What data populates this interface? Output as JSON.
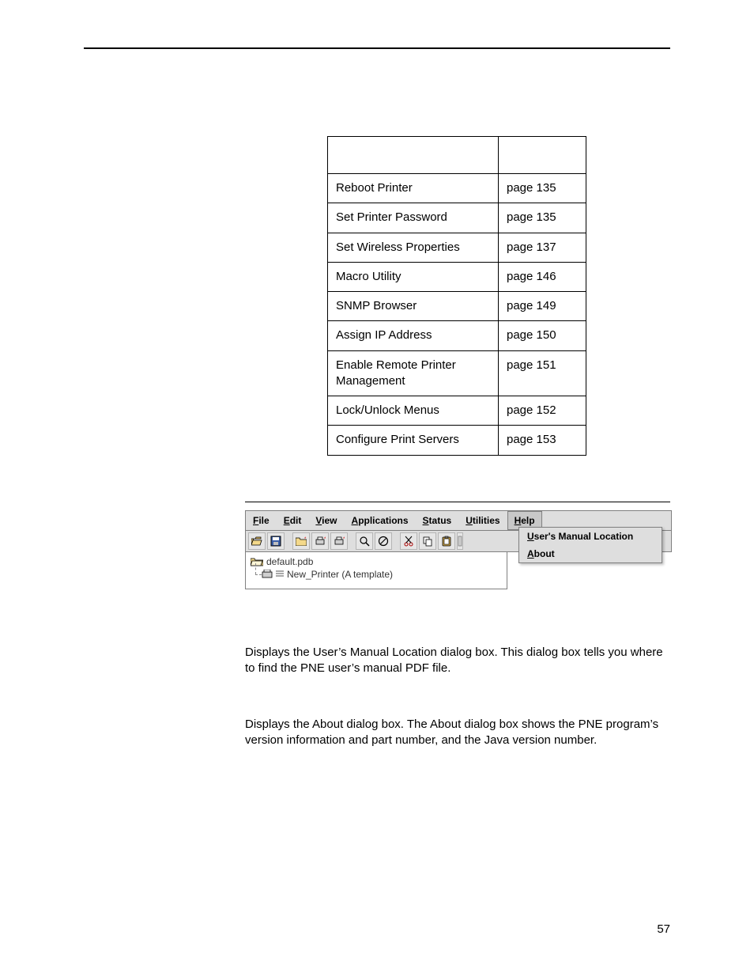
{
  "table": {
    "rows": [
      {
        "label": "Reboot Printer",
        "page": "page 135"
      },
      {
        "label": "Set Printer Password",
        "page": "page 135"
      },
      {
        "label": "Set Wireless Properties",
        "page": "page 137"
      },
      {
        "label": "Macro Utility",
        "page": "page 146"
      },
      {
        "label": "SNMP Browser",
        "page": "page 149"
      },
      {
        "label": "Assign IP Address",
        "page": "page 150"
      },
      {
        "label": "Enable Remote Printer Management",
        "page": "page 151"
      },
      {
        "label": "Lock/Unlock Menus",
        "page": "page 152"
      },
      {
        "label": "Configure Print Servers",
        "page": "page 153"
      }
    ]
  },
  "screenshot": {
    "menubar": {
      "file": {
        "ul": "F",
        "rest": "ile"
      },
      "edit": {
        "ul": "E",
        "rest": "dit"
      },
      "view": {
        "ul": "V",
        "rest": "iew"
      },
      "applications": {
        "ul": "A",
        "rest": "pplications"
      },
      "status": {
        "ul": "S",
        "rest": "tatus"
      },
      "utilities": {
        "ul": "U",
        "rest": "tilities"
      },
      "help": {
        "ul": "H",
        "rest": "elp"
      }
    },
    "dropdown": {
      "manual": {
        "ul": "U",
        "rest": "ser's Manual Location"
      },
      "about": {
        "ul": "A",
        "rest": "bout"
      }
    },
    "tree": {
      "root": "default.pdb",
      "child": "New_Printer (A template)"
    }
  },
  "paragraphs": {
    "p1": "Displays the User’s Manual Location dialog box. This dialog box tells you where to find the PNE user’s manual PDF file.",
    "p2": "Displays the About dialog box. The About dialog box shows the PNE program’s version information and part number, and the Java version number."
  },
  "page_number": "57"
}
